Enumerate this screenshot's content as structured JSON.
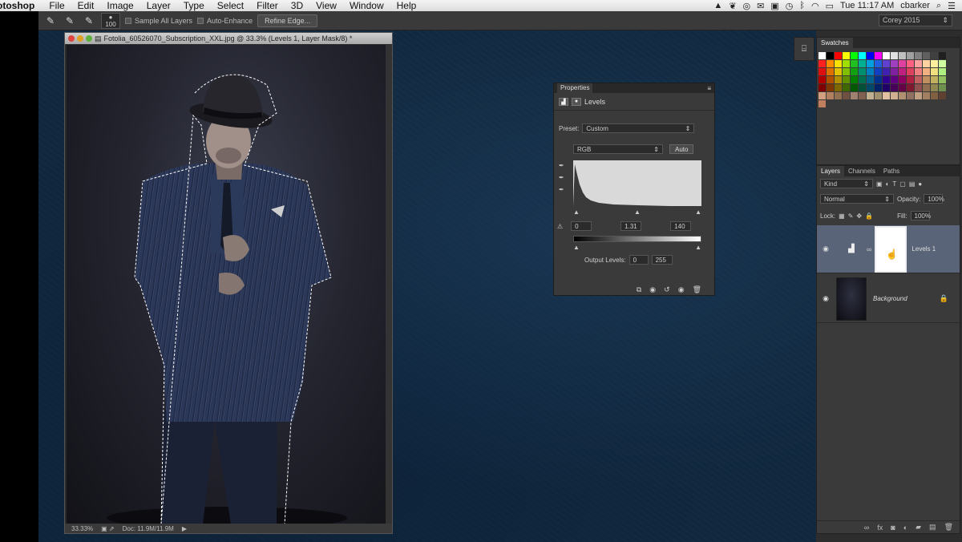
{
  "menubar": {
    "app": "otoshop",
    "menus": [
      "File",
      "Edit",
      "Image",
      "Layer",
      "Type",
      "Select",
      "Filter",
      "3D",
      "View",
      "Window",
      "Help"
    ],
    "clock": "Tue 11:17 AM",
    "user": "cbarker"
  },
  "options": {
    "brush_size": "100",
    "sample_all_layers": "Sample All Layers",
    "auto_enhance": "Auto-Enhance",
    "refine_edge": "Refine Edge...",
    "workspace": "Corey 2015"
  },
  "document": {
    "title": "Fotolia_60526070_Subscription_XXL.jpg @ 33.3% (Levels 1, Layer Mask/8) *",
    "zoom": "33.33%",
    "doc_size": "Doc: 11.9M/11.9M"
  },
  "properties": {
    "tab": "Properties",
    "header": "Levels",
    "preset_label": "Preset:",
    "preset_value": "Custom",
    "channel": "RGB",
    "auto": "Auto",
    "input_black": "0",
    "input_gamma": "1.31",
    "input_white": "140",
    "output_label": "Output Levels:",
    "output_black": "0",
    "output_white": "255"
  },
  "swatches": {
    "tab": "Swatches",
    "colors": [
      [
        "#ffffff",
        "#000000",
        "#ff0000",
        "#ffff00",
        "#00ff00",
        "#00ffff",
        "#0000ff",
        "#ff00ff",
        "#ffffff",
        "#e0e0e0",
        "#c0c0c0",
        "#a0a0a0",
        "#808080",
        "#606060",
        "#404040",
        "#202020"
      ],
      [
        "#ff2020",
        "#ff8c00",
        "#ffe000",
        "#a0e000",
        "#20c020",
        "#00b090",
        "#00a0e0",
        "#2060e0",
        "#6040d0",
        "#a040c0",
        "#e040a0",
        "#ff6080",
        "#ffa0a0",
        "#ffd0a0",
        "#fff0a0",
        "#d0ffa0"
      ],
      [
        "#e01010",
        "#e07000",
        "#e0c000",
        "#80c000",
        "#10a010",
        "#009070",
        "#0080c0",
        "#1040c0",
        "#4020b0",
        "#8020a0",
        "#c02080",
        "#e04060",
        "#f08080",
        "#f0b080",
        "#f0e080",
        "#b0f080"
      ],
      [
        "#b00000",
        "#b05000",
        "#b09000",
        "#609000",
        "#008000",
        "#007050",
        "#006090",
        "#003090",
        "#300090",
        "#600080",
        "#900060",
        "#b02040",
        "#c06060",
        "#c09060",
        "#c0b060",
        "#90c060"
      ],
      [
        "#800000",
        "#803800",
        "#806800",
        "#406800",
        "#005800",
        "#005038",
        "#004868",
        "#002068",
        "#200068",
        "#480058",
        "#680048",
        "#801830",
        "#905050",
        "#907050",
        "#908850",
        "#709050"
      ],
      [
        "#d0a080",
        "#b08060",
        "#907050",
        "#705040",
        "#a08070",
        "#806050",
        "#c0b090",
        "#a09070",
        "#e0c0a0",
        "#d0b090",
        "#b09070",
        "#907060",
        "#c0a080",
        "#a08060",
        "#806040",
        "#604030"
      ],
      [
        "#c08060"
      ]
    ]
  },
  "layers": {
    "tabs": [
      "Layers",
      "Channels",
      "Paths"
    ],
    "filter": "Kind",
    "blend_mode": "Normal",
    "opacity_label": "Opacity:",
    "opacity": "100%",
    "lock_label": "Lock:",
    "fill_label": "Fill:",
    "fill": "100%",
    "items": [
      {
        "name": "Levels 1"
      },
      {
        "name": "Background"
      }
    ]
  }
}
